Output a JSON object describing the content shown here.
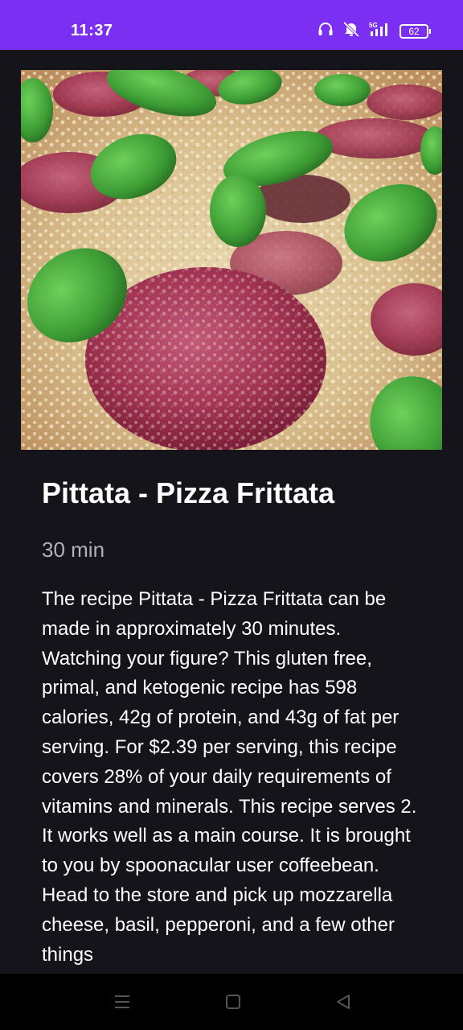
{
  "status_bar": {
    "time": "11:37",
    "network": "5G",
    "battery_level": "62",
    "icons": [
      "headphones-icon",
      "mute-icon",
      "signal-5g-icon",
      "battery-icon"
    ],
    "background_color": "#7b2ff2"
  },
  "recipe": {
    "image_alt": "pizza-frittata-photo",
    "title": "Pittata - Pizza Frittata",
    "time": "30 min",
    "summary": "The recipe Pittata - Pizza Frittata can be made in approximately 30 minutes. Watching your figure? This gluten free, primal, and ketogenic recipe has 598 calories, 42g of protein, and 43g of fat per serving. For $2.39 per serving, this recipe covers 28% of your daily requirements of vitamins and minerals. This recipe serves 2. It works well as a main course. It is brought to you by spoonacular user coffeebean. Head to the store and pick up mozzarella cheese, basil, pepperoni, and a few other things"
  },
  "nav_bar": {
    "icons": [
      "menu-icon",
      "home-icon",
      "back-icon"
    ]
  },
  "colors": {
    "background": "#15141a",
    "text_primary": "#ffffff",
    "text_secondary": "#b3b0b8"
  }
}
